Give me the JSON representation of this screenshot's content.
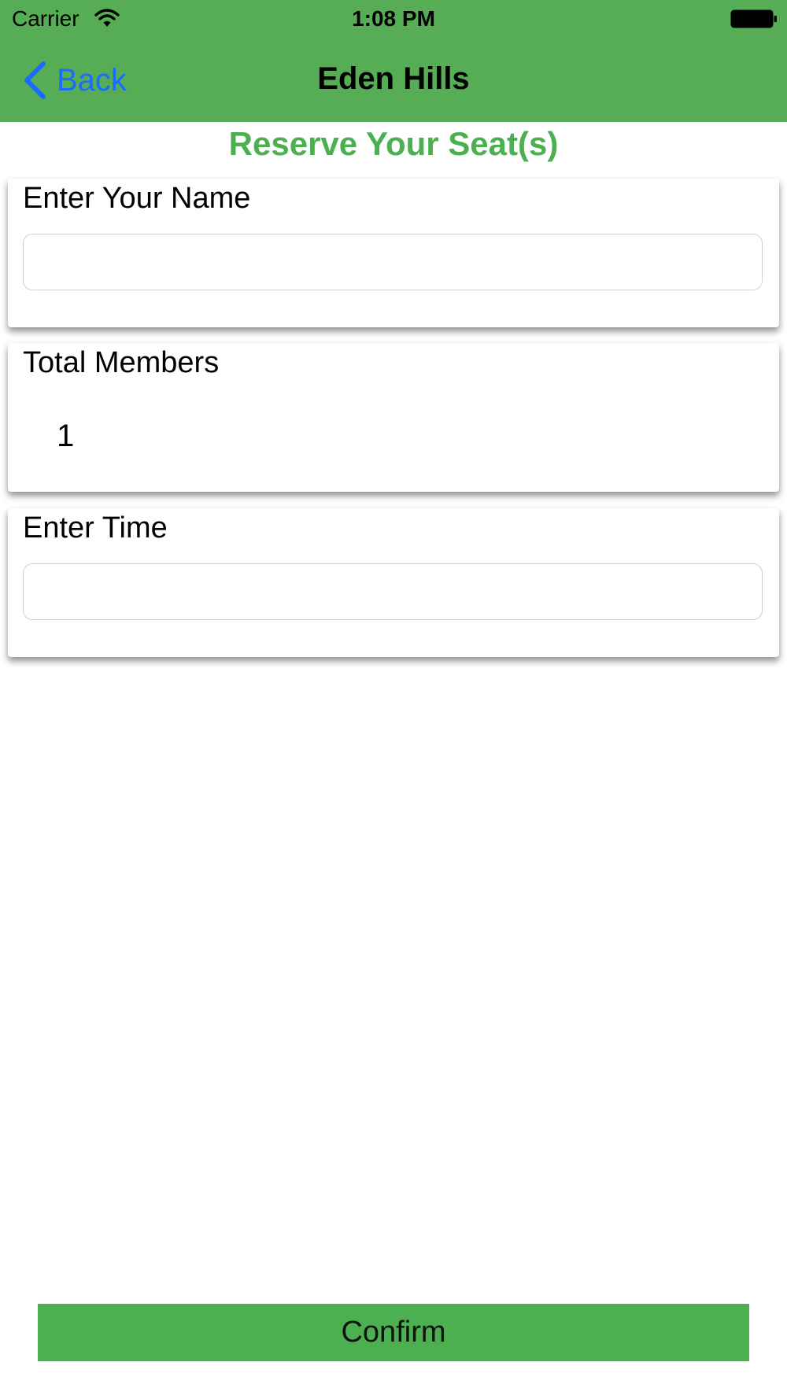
{
  "status_bar": {
    "carrier": "Carrier",
    "time": "1:08 PM",
    "wifi_icon": "wifi-icon",
    "battery_icon": "battery-icon"
  },
  "nav": {
    "back_label": "Back",
    "back_icon": "chevron-left-icon",
    "title": "Eden Hills",
    "background_color": "#56ad56",
    "back_color": "#1a6cff"
  },
  "heading": {
    "text": "Reserve Your Seat(s)",
    "color": "#4caf50"
  },
  "form": {
    "name": {
      "label": "Enter Your Name",
      "value": "",
      "placeholder": ""
    },
    "members": {
      "label": "Total Members",
      "value": "1"
    },
    "time": {
      "label": "Enter Time",
      "value": "",
      "placeholder": ""
    }
  },
  "confirm": {
    "label": "Confirm",
    "color": "#4caf50"
  }
}
